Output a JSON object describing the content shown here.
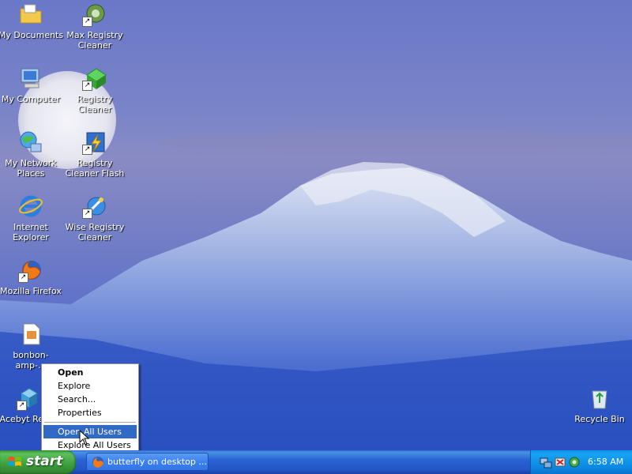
{
  "desktop_icons": [
    {
      "label": "My Documents"
    },
    {
      "label": "Max Registry Cleaner"
    },
    {
      "label": "My Computer"
    },
    {
      "label": "Registry Cleaner"
    },
    {
      "label": "My Network Places"
    },
    {
      "label": "Registry Cleaner Flash"
    },
    {
      "label": "Internet Explorer"
    },
    {
      "label": "Wise Registry Cleaner"
    },
    {
      "label": "Mozilla Firefox"
    },
    {
      "label": "bonbon-amp-..."
    },
    {
      "label": "Acebyt Regis."
    },
    {
      "label": "Recycle Bin"
    }
  ],
  "context_menu": {
    "items": [
      {
        "label": "Open",
        "default": true
      },
      {
        "label": "Explore"
      },
      {
        "label": "Search..."
      },
      {
        "label": "Properties"
      },
      {
        "label": "Open All Users",
        "highlighted": true
      },
      {
        "label": "Explore All Users"
      }
    ]
  },
  "taskbar": {
    "start_label": "start",
    "tasks": [
      {
        "label": "butterfly on desktop ..."
      }
    ],
    "clock": "6:58 AM"
  }
}
